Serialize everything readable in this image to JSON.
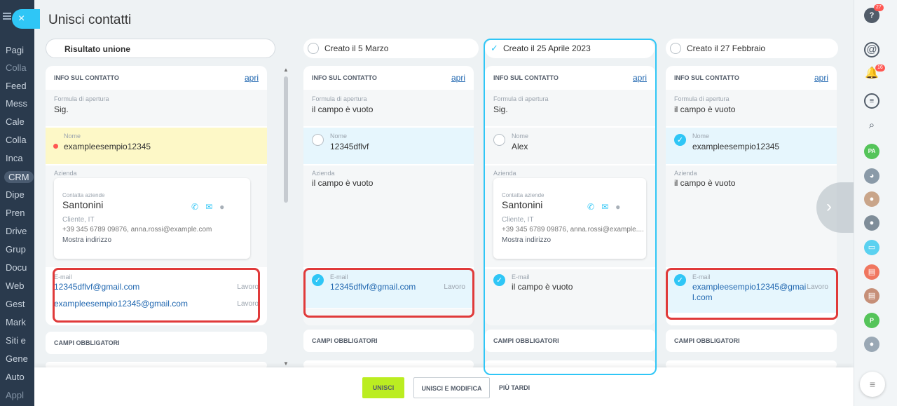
{
  "nav": {
    "items": [
      "Pagi",
      "Colla",
      "Feed",
      "Mess",
      "Cale",
      "Colla",
      "Inca",
      "CRM",
      "Dipe",
      "Pren",
      "Drive",
      "Grup",
      "Docu",
      "Web",
      "Gest",
      "Mark",
      "Siti e",
      "Gene",
      "Auto",
      "Appl"
    ]
  },
  "title": "Unisci contatti",
  "close_symbol": "×",
  "columns": {
    "result": {
      "label": "Risultato unione"
    },
    "c1": {
      "label": "Creato il 5 Marzo"
    },
    "c2": {
      "label": "Creato il 25 Aprile 2023",
      "check": "✓"
    },
    "c3": {
      "label": "Creato il 27 Febbraio"
    }
  },
  "section": {
    "info": "INFO SUL CONTATTO",
    "open": "apri",
    "required": "CAMPI OBBLIGATORI"
  },
  "labels": {
    "salutation": "Formula di apertura",
    "name": "Nome",
    "company": "Azienda",
    "email": "E-mail",
    "contact_company": "Contatta aziende",
    "work": "Lavoro"
  },
  "result": {
    "salutation": "Sig.",
    "name": "exampleesempio12345",
    "company_name": "Santonini",
    "company_sub": "Cliente, IT",
    "company_phone": "+39 345 6789 09876, anna.rossi@example.com",
    "company_addr": "Mostra indirizzo",
    "email1": "12345dflvf@gmail.com",
    "email2": "exampleesempio12345@gmail.com"
  },
  "c1": {
    "salutation": "il campo è vuoto",
    "name": "12345dflvf",
    "company": "il campo è vuoto",
    "email": "12345dflvf@gmail.com"
  },
  "c2": {
    "salutation": "Sig.",
    "name": "Alex",
    "company_name": "Santonini",
    "company_sub": "Cliente, IT",
    "company_phone": "+39 345 6789 09876, anna.rossi@example....",
    "company_addr": "Mostra indirizzo",
    "email": "il campo è vuoto"
  },
  "c3": {
    "salutation": "il campo è vuoto",
    "name": "exampleesempio12345",
    "company": "il campo è vuoto",
    "email_line1": "exampleesempio12345@gmai",
    "email_line2": "l.com"
  },
  "footer": {
    "merge": "UNISCI",
    "merge_edit": "UNISCI E MODIFICA",
    "later": "PIÙ TARDI"
  },
  "rightbar": {
    "help_badge": "27",
    "bell_badge": "16",
    "pa": "PA",
    "p": "P"
  },
  "colors": {
    "accent": "#2fc6f6",
    "highlight": "#e03a3a",
    "primary_button": "#bbed21"
  }
}
